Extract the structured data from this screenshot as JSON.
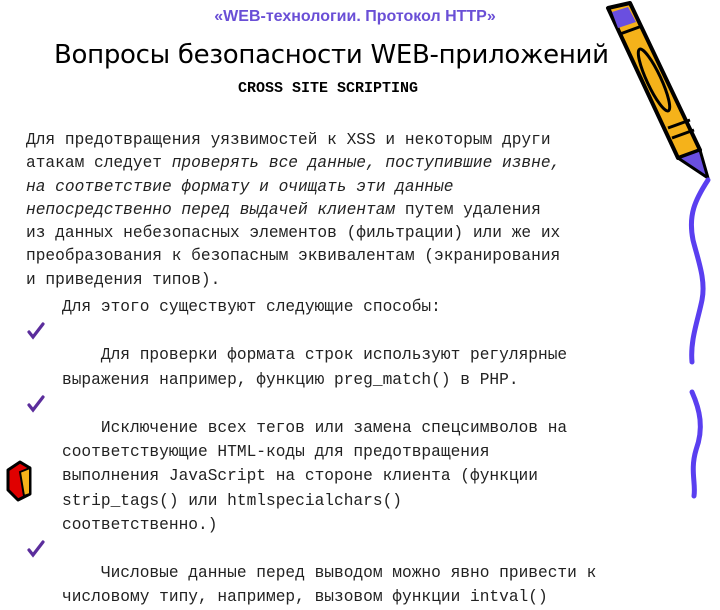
{
  "header": {
    "course_title": "«WEB-технологии. Протокол HTTP»"
  },
  "slide": {
    "title": "Вопросы безопасности WEB-приложений",
    "subtitle": "CROSS SITE SCRIPTING"
  },
  "paragraph": {
    "line1": "Для предотвращения уязвимостей к XSS и некоторым други",
    "line2_a": "атакам следует ",
    "line2_b": "проверять все данные, поступившие извне,",
    "line3": "на соответствие формату и очищать эти данные",
    "line4_a": "непосредственно перед выдачей клиентам",
    "line4_b": " путем удаления",
    "line5": "из данных небезопасных элементов (фильтрации) или же их",
    "line6": "преобразования к безопасным эквивалентам (экранирования",
    "line7": "и приведения типов)."
  },
  "methods": {
    "intro": "Для этого существуют следующие способы:",
    "items": [
      {
        "lines": [
          "Для проверки формата строк используют регулярные",
          "выражения например, функцию preg_match() в PHP."
        ]
      },
      {
        "lines": [
          "Исключение всех тегов или замена спецсимволов на",
          "соответствующие HTML-коды для предотвращения",
          "выполнения JavaScript на стороне клиента (функции",
          "strip_tags() или htmlspecialchars()",
          "соответственно.)"
        ]
      },
      {
        "lines": [
          "Числовые данные перед выводом можно явно привести к",
          "числовому типу, например, вызовом функции intval()"
        ]
      }
    ]
  },
  "icons": {
    "bullet": "checkmark-icon",
    "decoration_top_right": "pencil-icon",
    "decoration_bottom_left": "pencil-eraser-icon"
  },
  "colors": {
    "accent": "#6a4fd6",
    "check": "#5b2d9c",
    "pencil_yellow": "#f5b21a",
    "squiggle": "#5a3ff0"
  }
}
